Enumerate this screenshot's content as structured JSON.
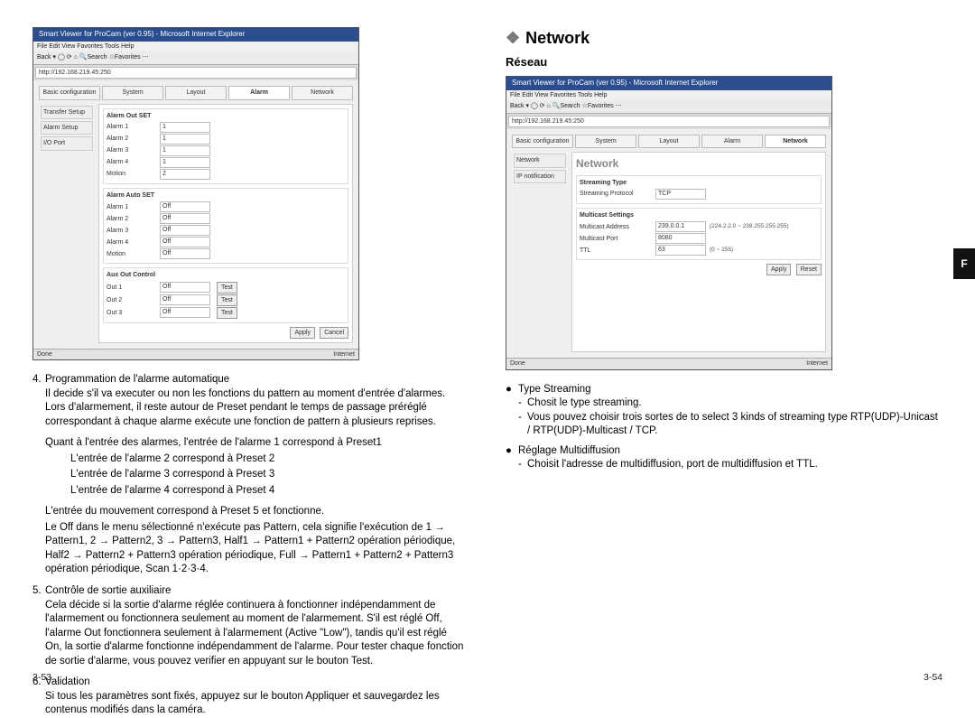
{
  "page_left_num": "3-53",
  "page_right_num": "3-54",
  "side_tab": "F",
  "shotL": {
    "title": "Smart Viewer for ProCam (ver 0.95) - Microsoft Internet Explorer",
    "menubar": "File  Edit  View  Favorites  Tools  Help",
    "toolbar": "Back  ▾   ◯   ⟳   ⌂   🔍Search  ☆Favorites  ⋯",
    "address": "http://192.168.219.45:250",
    "tabs": [
      "Basic configuration",
      "System",
      "Layout",
      "Alarm",
      "Network"
    ],
    "active_tab": 3,
    "sidebar": [
      "Transfer Setup",
      "Alarm Setup",
      "I/O Port"
    ],
    "alarm_out_set": {
      "title": "Alarm Out SET",
      "rows": [
        {
          "label": "Alarm 1",
          "value": "1"
        },
        {
          "label": "Alarm 2",
          "value": "1"
        },
        {
          "label": "Alarm 3",
          "value": "1"
        },
        {
          "label": "Alarm 4",
          "value": "1"
        },
        {
          "label": "Motion",
          "value": "2"
        }
      ]
    },
    "alarm_auto_set": {
      "title": "Alarm Auto SET",
      "rows": [
        {
          "label": "Alarm 1",
          "value": "Off"
        },
        {
          "label": "Alarm 2",
          "value": "Off"
        },
        {
          "label": "Alarm 3",
          "value": "Off"
        },
        {
          "label": "Alarm 4",
          "value": "Off"
        },
        {
          "label": "Motion",
          "value": "Off"
        }
      ]
    },
    "aux_out": {
      "title": "Aux Out Control",
      "rows": [
        {
          "label": "Out 1",
          "value": "Off",
          "btn": "Test"
        },
        {
          "label": "Out 2",
          "value": "Off",
          "btn": "Test"
        },
        {
          "label": "Out 3",
          "value": "Off",
          "btn": "Test"
        }
      ]
    },
    "apply": "Apply",
    "cancel": "Cancel",
    "status_left": "Done",
    "status_right": "Internet"
  },
  "left_text": {
    "item4_title": "Programmation de l'alarme automatique",
    "item4_p1": "Il decide s'il va executer ou non les fonctions du pattern au moment d'entrée d'alarmes. Lors d'alarmement, il reste autour de Preset pendant le temps de passage préréglé correspondant à chaque alarme exécute une fonction de pattern à plusieurs reprises.",
    "item4_p2": "Quant à l'entrée des alarmes, l'entrée de l'alarme 1 correspond à Preset1",
    "item4_l2": "L'entrée de l'alarme 2 correspond à Preset 2",
    "item4_l3": "L'entrée de l'alarme 3 correspond à Preset 3",
    "item4_l4": "L'entrée de l'alarme 4 correspond à Preset 4",
    "item4_p3": "L'entrée du mouvement correspond à Preset 5 et fonctionne.",
    "item4_p4": "Le Off dans le menu sélectionné n'exécute pas Pattern, cela signifie l'exécution de 1 → Pattern1, 2 → Pattern2, 3 → Pattern3, Half1 → Pattern1 + Pattern2 opération périodique, Half2 → Pattern2 + Pattern3 opération périodique, Full → Pattern1 + Pattern2 + Pattern3 opération périodique, Scan 1·2·3·4.",
    "item5_title": "Contrôle de sortie auxiliaire",
    "item5_p1": "Cela décide si la sortie d'alarme réglée continuera à fonctionner indépendamment de l'alarmement ou fonctionnera seulement au moment de l'alarmement. S'il est réglé Off, l'alarme Out fonctionnera seulement à l'alarmement (Active \"Low\"), tandis qu'il est réglé On, la sortie d'alarme fonctionne indépendamment de l'alarme. Pour tester chaque fonction de sortie d'alarme, vous pouvez verifier en appuyant sur le bouton Test.",
    "item6_title": "Validation",
    "item6_p1": "Si tous les paramètres sont fixés, appuyez sur le bouton Appliquer et sauvegardez les contenus modifiés dans la caméra."
  },
  "right_heading": "Network",
  "right_sub": "Réseau",
  "shotR": {
    "title": "Smart Viewer for ProCam (ver 0.95) - Microsoft Internet Explorer",
    "menubar": "File  Edit  View  Favorites  Tools  Help",
    "toolbar": "Back  ▾   ◯   ⟳   ⌂   🔍Search  ☆Favorites  ⋯",
    "address": "http://192.168.219.45:250",
    "tabs": [
      "Basic configuration",
      "System",
      "Layout",
      "Alarm",
      "Network"
    ],
    "active_tab": 4,
    "sidebar": [
      "Network",
      "IP notification"
    ],
    "panel_title": "Network",
    "streaming": {
      "title": "Streaming Type",
      "label": "Streaming Protocol",
      "value": "TCP"
    },
    "multicast": {
      "title": "Multicast Settings",
      "rows": [
        {
          "label": "Multicast Address",
          "value": "239.0.0.1",
          "hint": "(224.2.2.0 ~ 239.255.255.255)"
        },
        {
          "label": "Multicast Port",
          "value": "8080",
          "hint": ""
        },
        {
          "label": "TTL",
          "value": "63",
          "hint": "(0 ~ 255)"
        }
      ]
    },
    "apply": "Apply",
    "reset": "Reset",
    "status_left": "Done",
    "status_right": "Internet"
  },
  "right_text": {
    "b1_title": "Type Streaming",
    "b1_d1": "Chosit le type streaming.",
    "b1_d2": "Vous pouvez choisir trois sortes de to select 3 kinds of streaming type RTP(UDP)-Unicast / RTP(UDP)-Multicast / TCP.",
    "b2_title": "Réglage Multidiffusion",
    "b2_d1": "Choisit l'adresse de multidiffusion, port de multidiffusion et TTL."
  }
}
